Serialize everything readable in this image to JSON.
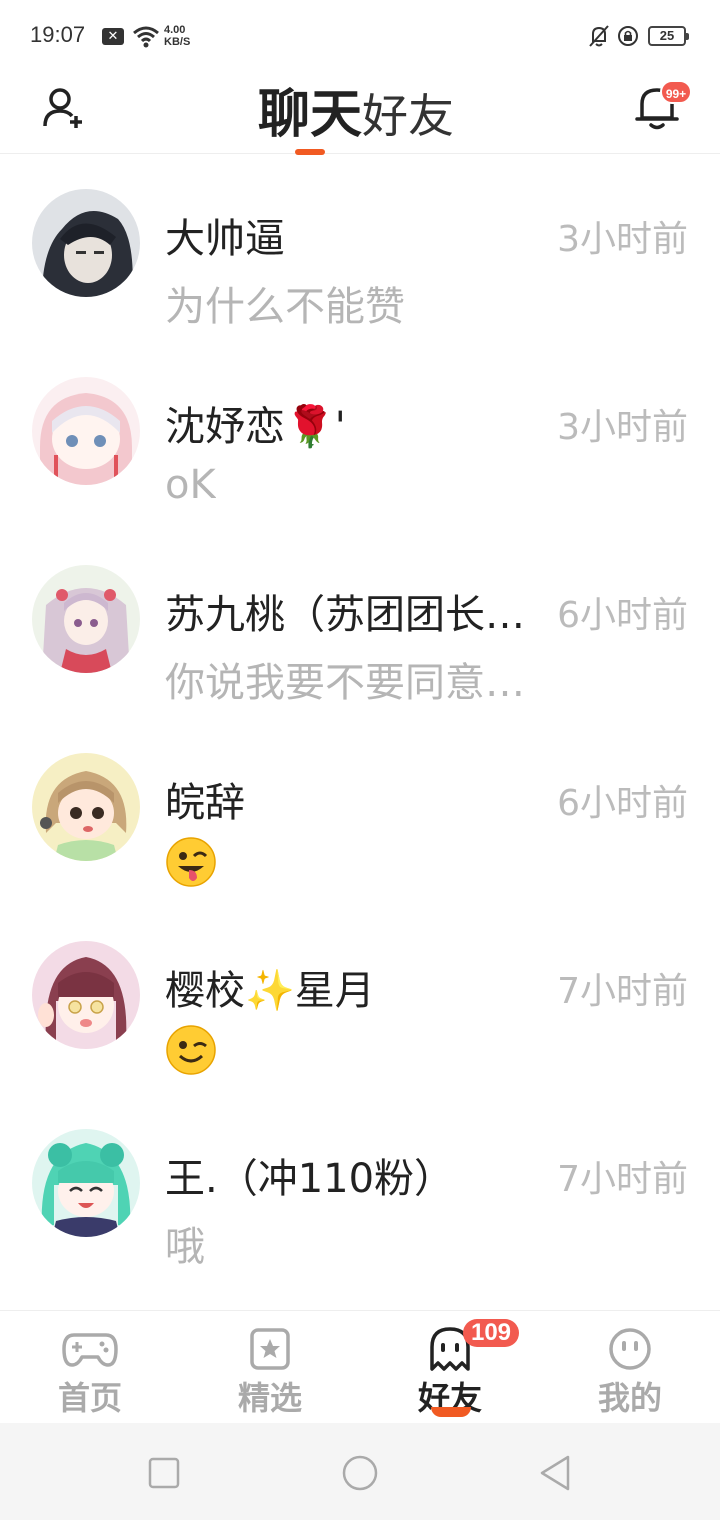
{
  "status_bar": {
    "time": "19:07",
    "net_speed_value": "4.00",
    "net_speed_unit": "KB/S",
    "battery": "25",
    "notification_glyph": "✕"
  },
  "header": {
    "tab_chat": "聊天",
    "tab_friends": "好友",
    "notification_badge": "99+"
  },
  "chats": [
    {
      "name": "大帅逼",
      "message": "为什么不能赞",
      "time": "3小时前",
      "avatar_color": "#3a3f4a"
    },
    {
      "name": "沈妤恋🌹'",
      "message": "oK",
      "time": "3小时前",
      "avatar_color": "#f2c9cf"
    },
    {
      "name": "苏九桃（苏团团长…",
      "message": "你说我要不要同意…",
      "time": "6小时前",
      "avatar_color": "#d9b8c9"
    },
    {
      "name": "皖辞",
      "message": "",
      "message_emoji": "winking-face-with-tongue",
      "time": "6小时前",
      "avatar_color": "#f0e6a8"
    },
    {
      "name": "樱校✨星月",
      "message": "",
      "message_emoji": "winking-face",
      "time": "7小时前",
      "avatar_color": "#e7c3d4"
    },
    {
      "name": "王.（冲110粉）",
      "message": "哦",
      "time": "7小时前",
      "avatar_color": "#7fd9c4"
    }
  ],
  "bottom_nav": {
    "items": [
      {
        "label": "首页",
        "icon": "gamepad-icon"
      },
      {
        "label": "精选",
        "icon": "star-bookmark-icon"
      },
      {
        "label": "好友",
        "icon": "ghost-icon",
        "badge": "109",
        "active": true
      },
      {
        "label": "我的",
        "icon": "face-icon"
      }
    ]
  },
  "colors": {
    "accent": "#f15a22",
    "badge": "#f25a4f",
    "secondary_text": "#b5b5b5"
  }
}
